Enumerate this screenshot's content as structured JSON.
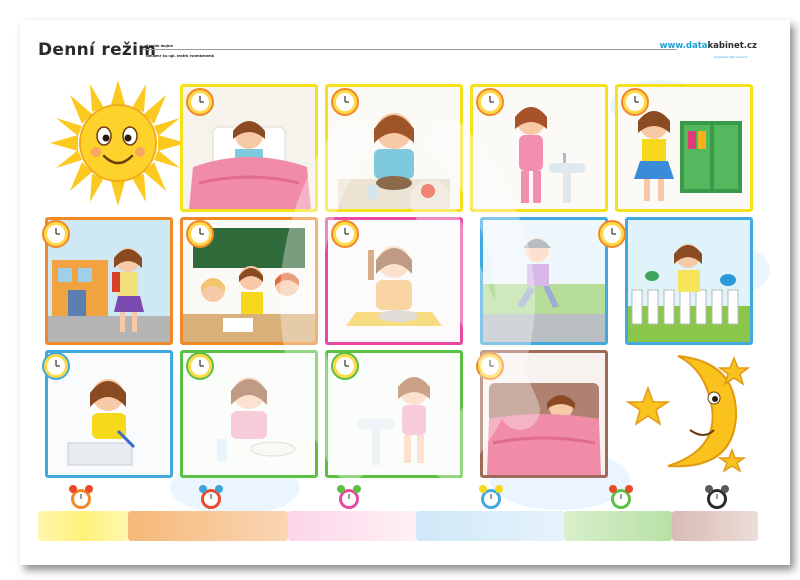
{
  "header": {
    "title": "Denní režim",
    "meta_line1": "Saujnk mujne",
    "meta_line2": "Nmkenr ku sgl. mstrk rsnmkmnmk",
    "brand_prefix": "www.data",
    "brand_suffix": "kabinet.cz",
    "brand_sub": "Anjmnknk Kiln Anmnd"
  },
  "colors": {
    "yellow": "#f5e11a",
    "orange": "#f08a28",
    "pink": "#e84aa0",
    "blue": "#42a8e0",
    "green": "#5cc043",
    "brown": "#a06a5a"
  },
  "activities": [
    {
      "name": "waking-up",
      "frame": "yellow"
    },
    {
      "name": "breakfast",
      "frame": "yellow"
    },
    {
      "name": "washing",
      "frame": "yellow"
    },
    {
      "name": "dressing",
      "frame": "yellow"
    },
    {
      "name": "going-to-school",
      "frame": "orange"
    },
    {
      "name": "at-school",
      "frame": "orange"
    },
    {
      "name": "lunch",
      "frame": "pink"
    },
    {
      "name": "skating",
      "frame": "blue"
    },
    {
      "name": "playing-with-birds",
      "frame": "blue"
    },
    {
      "name": "homework",
      "frame": "blue"
    },
    {
      "name": "dinner",
      "frame": "green"
    },
    {
      "name": "brushing-teeth",
      "frame": "green"
    },
    {
      "name": "sleeping",
      "frame": "brown"
    }
  ],
  "footer_strips": [
    "yellow",
    "orange",
    "pink",
    "blue",
    "green",
    "brown"
  ],
  "icons": [
    "sun-icon",
    "moon-icon",
    "star-icon",
    "clock-icon",
    "alarm-clock-icon"
  ]
}
